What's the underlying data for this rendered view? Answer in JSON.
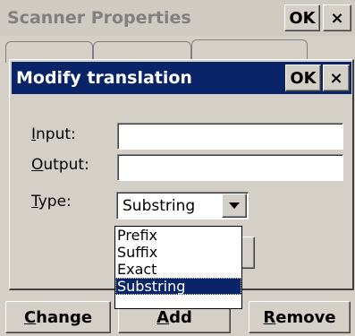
{
  "background_window": {
    "title": "Scanner Properties",
    "ok_label": "OK",
    "close_label": "×",
    "buttons": {
      "change": {
        "mnemonic": "C",
        "rest": "hange"
      },
      "add": {
        "mnemonic": "A",
        "rest": "dd"
      },
      "remove": {
        "mnemonic": "R",
        "rest": "emove"
      }
    }
  },
  "dialog": {
    "title": "Modify translation",
    "ok_label": "OK",
    "close_label": "×",
    "fields": {
      "input": {
        "mnemonic": "I",
        "rest": "nput:",
        "value": ""
      },
      "output": {
        "mnemonic": "O",
        "rest": "utput:",
        "value": ""
      },
      "type": {
        "mnemonic": "T",
        "rest": "ype:",
        "value": "Substring"
      }
    },
    "dropdown_options": [
      "Prefix",
      "Suffix",
      "Exact",
      "Substring"
    ],
    "selected_option": "Substring"
  },
  "colors": {
    "titlebar_active": "#0a246a",
    "face": "#d4d0c8"
  },
  "icons": {
    "dropdown_arrow": "chevron-down-icon"
  }
}
